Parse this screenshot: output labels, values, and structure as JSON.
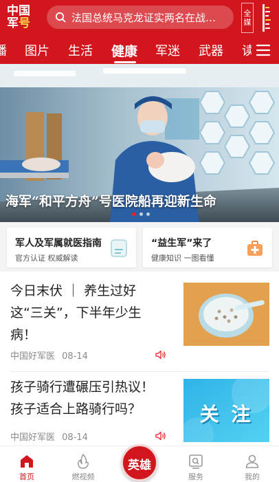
{
  "header": {
    "logo_line1": "中国",
    "logo_line2_a": "军",
    "logo_line2_b": "号",
    "search_placeholder": "法国总统马克龙证实两名在战…",
    "media_label": "全媒"
  },
  "tabs": [
    {
      "label": "播"
    },
    {
      "label": "图片"
    },
    {
      "label": "生活"
    },
    {
      "label": "健康",
      "active": true
    },
    {
      "label": "军迷"
    },
    {
      "label": "武器"
    },
    {
      "label": "读"
    }
  ],
  "banner": {
    "title": "海军“和平方舟”号医院船再迎新生命",
    "page_count": 3,
    "active_page": 1
  },
  "service_cards": [
    {
      "title": "军人及军属就医指南",
      "subtitle": "官方认证 权威解读",
      "icon": "document-icon"
    },
    {
      "title": "“益生军”来了",
      "subtitle": "健康知识 一图看懂",
      "icon": "medical-kit-icon"
    }
  ],
  "news": [
    {
      "title": "今日末伏 ｜ 养生过好这“三关”，下半年少生病！",
      "source": "中国好军医",
      "date": "08-14",
      "thumb": "porridge-bowl-image"
    },
    {
      "title": "孩子骑行遭碾压引热议！孩子适合上路骑行吗？",
      "source": "中国好军医",
      "date": "08-14",
      "thumb_text": "关 注"
    }
  ],
  "bottom_nav": [
    {
      "label": "首页",
      "icon": "home-icon",
      "active": true
    },
    {
      "label": "燃视频",
      "icon": "flame-video-icon"
    },
    {
      "label": "英雄",
      "icon": "hero-icon"
    },
    {
      "label": "服务",
      "icon": "service-icon"
    },
    {
      "label": "我的",
      "icon": "profile-icon"
    }
  ],
  "colors": {
    "brand_red": "#d2161e",
    "accent_yellow": "#ffd84a",
    "text_dark": "#222222",
    "text_gray": "#8a8a8a"
  }
}
